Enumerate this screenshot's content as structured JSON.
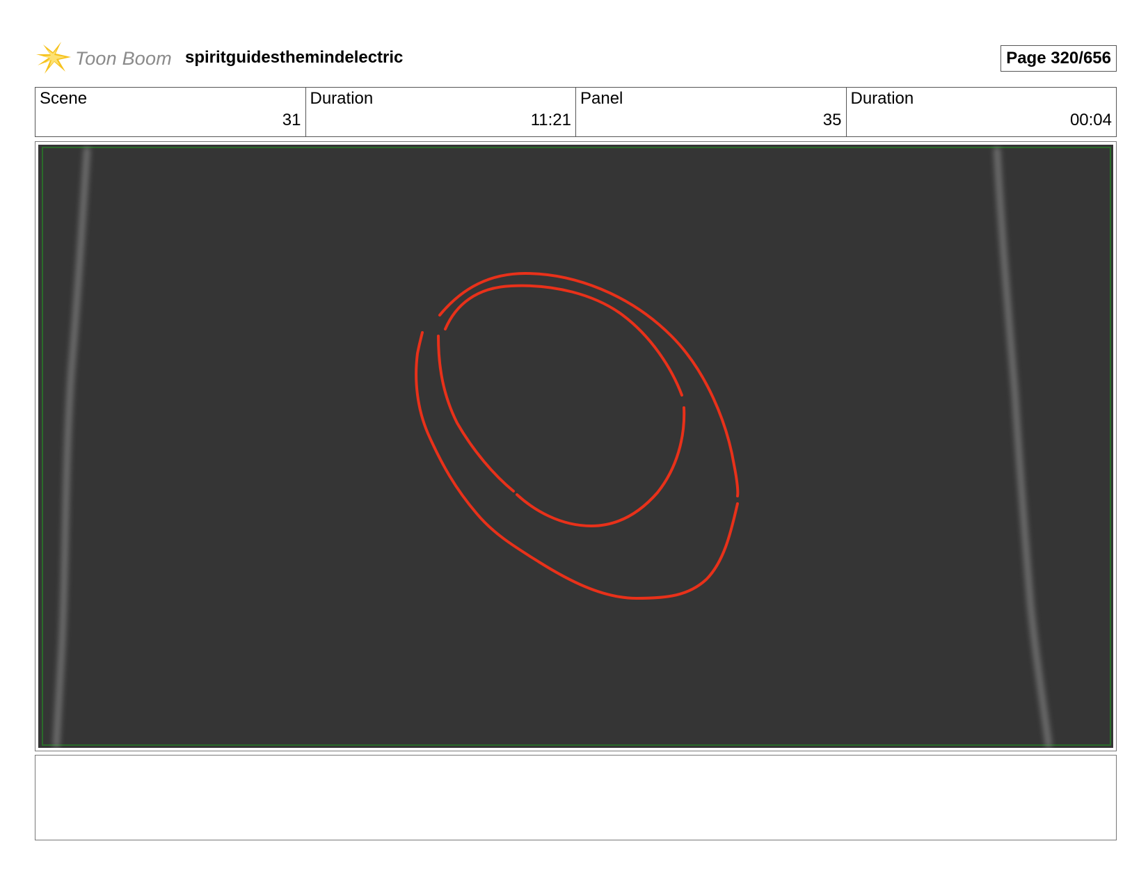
{
  "header": {
    "logo_text": "Toon Boom",
    "project_title": "spiritguidesthemindelectric",
    "page_label": "Page 320/656"
  },
  "info": {
    "scene_label": "Scene",
    "scene_value": "31",
    "scene_duration_label": "Duration",
    "scene_duration_value": "11:21",
    "panel_label": "Panel",
    "panel_value": "35",
    "panel_duration_label": "Duration",
    "panel_duration_value": "00:04"
  },
  "panel": {
    "background_color": "#353535",
    "stroke_color": "#e8311a",
    "safe_area_color": "#2a6b2a"
  },
  "notes": {
    "text": ""
  }
}
